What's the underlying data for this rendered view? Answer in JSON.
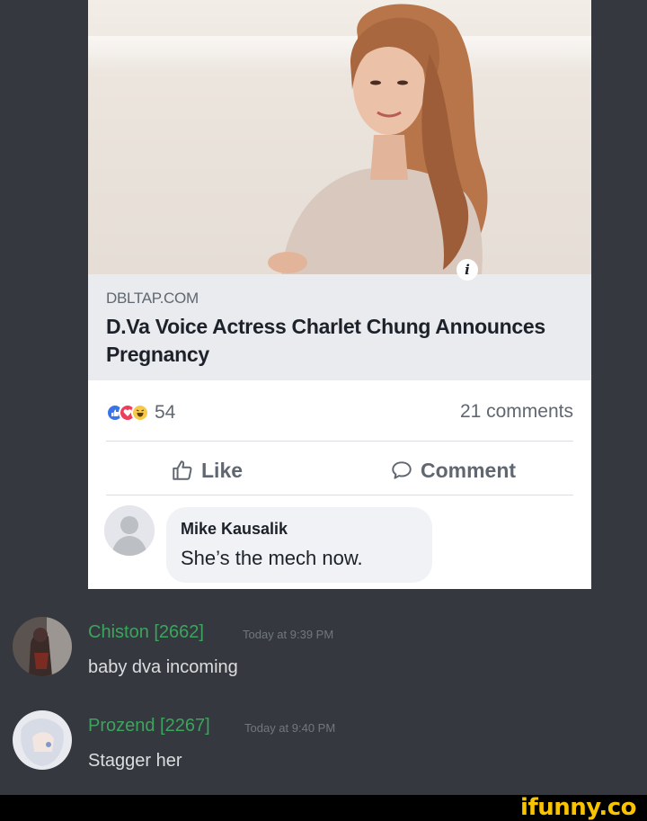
{
  "post": {
    "domain": "DBLTAP.COM",
    "headline": "D.Va Voice Actress Charlet Chung Announces Pregnancy",
    "reaction_count": "54",
    "comments_count": "21 comments",
    "like_label": "Like",
    "comment_label": "Comment",
    "comment": {
      "author": "Mike Kausalik",
      "text": "She’s the mech now."
    }
  },
  "messages": [
    {
      "username": "Chiston [2662]",
      "timestamp": "Today at 9:39 PM",
      "text": "baby dva incoming"
    },
    {
      "username": "Prozend [2267]",
      "timestamp": "Today at 9:40 PM",
      "text": "Stagger her"
    }
  ],
  "watermark": "ifunny.co",
  "colors": {
    "background": "#35393f",
    "username": "#3ba55d",
    "watermark": "#f8c300",
    "like_blue": "#3b73e8"
  }
}
